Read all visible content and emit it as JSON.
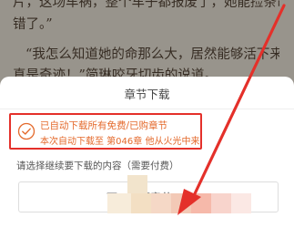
{
  "reader": {
    "lines": [
      "片，这场车祸，整个车子都报废了，她能捡条命就不",
      "错了。”",
      "“我怎么知道她的命那么大，居然能够活下来，",
      "真是奇迹！”简琳咬牙切齿的说道。"
    ]
  },
  "sheet": {
    "title": "章节下载",
    "status_line1": "已自动下载所有免费/已购章节",
    "status_line2": "本次自动下载至 第046章 他从火光中来",
    "prompt": "请选择继续要下载的内容（需要付费）",
    "download_button_label": "下……都章节"
  },
  "colors": {
    "highlight_red": "#e4302a",
    "status_orange": "#e46a2c"
  }
}
